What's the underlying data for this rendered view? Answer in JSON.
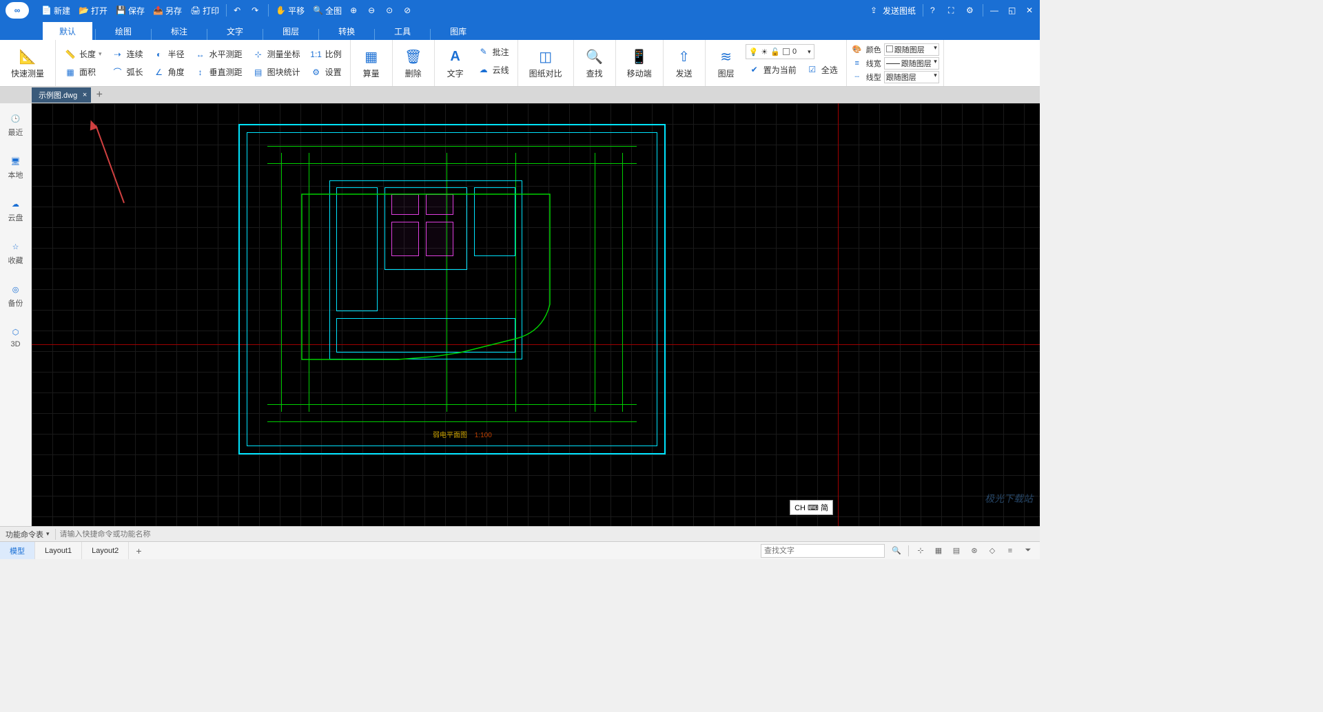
{
  "quickbar": {
    "new": "新建",
    "open": "打开",
    "save": "保存",
    "saveas": "另存",
    "print": "打印",
    "pan": "平移",
    "fit": "全图",
    "send_drawing": "发送图纸"
  },
  "ribbon_tabs": [
    "默认",
    "绘图",
    "标注",
    "文字",
    "图层",
    "转换",
    "工具",
    "图库"
  ],
  "active_ribbon_tab": "默认",
  "ribbon": {
    "quickMeasure": "快速测量",
    "length": "长度",
    "continuous": "连续",
    "radius": "半径",
    "hdist": "水平测距",
    "mcoord": "测量坐标",
    "scale": "比例",
    "area": "面积",
    "arc": "弧长",
    "angle": "角度",
    "vdist": "垂直测距",
    "blockstat": "图块统计",
    "settings": "设置",
    "calc": "算量",
    "delete": "删除",
    "text": "文字",
    "annotate": "批注",
    "cloud": "云线",
    "compare": "图纸对比",
    "find": "查找",
    "mobile": "移动端",
    "send": "发送",
    "layer": "图层",
    "setcur": "置为当前",
    "selall": "全选",
    "layer_value": "0",
    "color_lbl": "颜色",
    "color_val": "跟随图层",
    "lw_lbl": "线宽",
    "lw_val": "跟随图层",
    "lt_lbl": "线型",
    "lt_val": "跟随图层"
  },
  "file_tab": {
    "name": "示例图.dwg"
  },
  "sidebar": [
    "最近",
    "本地",
    "云盘",
    "收藏",
    "备份",
    "3D"
  ],
  "drawing": {
    "title": "弱电平面图",
    "scale": "1:100"
  },
  "ime_indicator": "CH ⌨ 简",
  "cmdbar": {
    "label": "功能命令表",
    "placeholder": "请输入快捷命令或功能名称"
  },
  "layouts": {
    "tabs": [
      "模型",
      "Layout1",
      "Layout2"
    ],
    "active": "模型",
    "search_placeholder": "查找文字"
  },
  "watermark": "极光下载站"
}
